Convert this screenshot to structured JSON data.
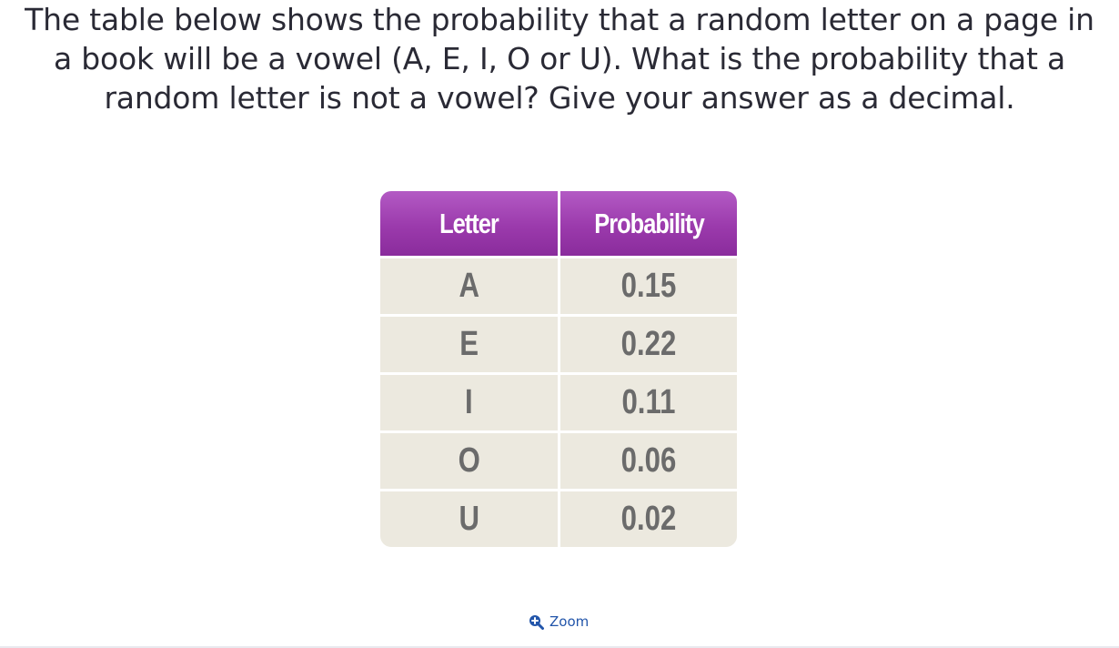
{
  "question": {
    "text": "The table below shows the probability that a random letter on a page in a book will be a vowel (A, E, I, O or U). What is the probability that a random letter is not a vowel? Give your answer as a decimal."
  },
  "table": {
    "headers": {
      "letter": "Letter",
      "probability": "Probability"
    },
    "rows": [
      {
        "letter": "A",
        "probability": "0.15"
      },
      {
        "letter": "E",
        "probability": "0.22"
      },
      {
        "letter": "I",
        "probability": "0.11"
      },
      {
        "letter": "O",
        "probability": "0.06"
      },
      {
        "letter": "U",
        "probability": "0.02"
      }
    ],
    "colors": {
      "header_top": "#b35ac4",
      "header_bottom": "#8a2c9c",
      "cell_bg": "#ece9df",
      "cell_text": "#6b6b6b"
    }
  },
  "zoom": {
    "label": "Zoom",
    "icon": "zoom-in-icon",
    "color": "#2255aa"
  }
}
